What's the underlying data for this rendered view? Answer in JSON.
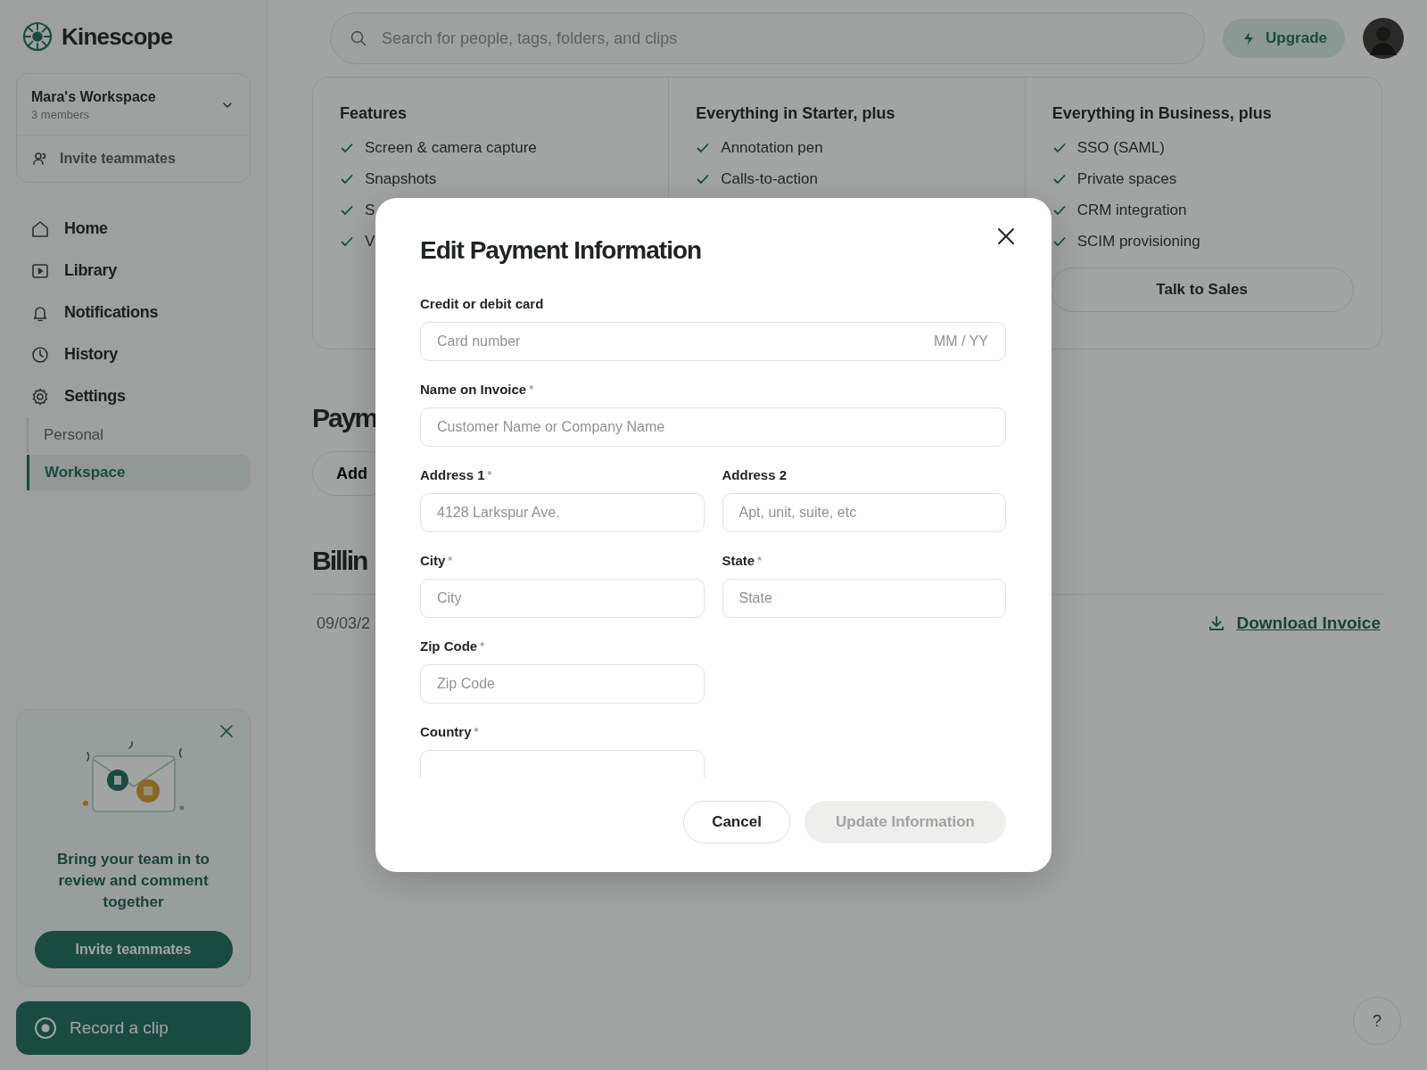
{
  "logo": {
    "text": "Kinescope"
  },
  "workspace": {
    "name": "Mara's Workspace",
    "members": "3 members",
    "invite": "Invite teammates"
  },
  "nav": [
    {
      "label": "Home"
    },
    {
      "label": "Library"
    },
    {
      "label": "Notifications"
    },
    {
      "label": "History"
    },
    {
      "label": "Settings"
    }
  ],
  "settings_sub": [
    {
      "label": "Personal",
      "selected": false
    },
    {
      "label": "Workspace",
      "selected": true
    }
  ],
  "promo": {
    "text": "Bring your team in to review and comment together",
    "button": "Invite teammates"
  },
  "record_button": "Record a clip",
  "search": {
    "placeholder": "Search for people, tags, folders, and clips"
  },
  "upgrade_button": "Upgrade",
  "plans": [
    {
      "heading": "Features",
      "features": [
        "Screen & camera capture",
        "Snapshots",
        "S",
        "V"
      ]
    },
    {
      "heading": "Everything in Starter, plus",
      "features": [
        "Annotation pen",
        "Calls-to-action"
      ]
    },
    {
      "heading": "Everything in Business, plus",
      "features": [
        "SSO (SAML)",
        "Private spaces",
        "CRM integration",
        "SCIM provisioning"
      ],
      "button": "Talk to Sales"
    }
  ],
  "payment": {
    "heading": "Paym",
    "button": "Add"
  },
  "billing": {
    "heading": "Billin",
    "rows": [
      {
        "date": "09/03/2",
        "link": "Download Invoice"
      }
    ]
  },
  "help_button": "?",
  "modal": {
    "title": "Edit Payment Information",
    "fields": [
      {
        "kind": "card",
        "label": "Credit or debit card",
        "placeholder": "Card number",
        "suffix": "MM / YY"
      },
      {
        "kind": "full",
        "label": "Name on Invoice",
        "required_mark": "*",
        "placeholder": "Customer Name or Company Name"
      },
      {
        "kind": "half",
        "label": "Address 1",
        "required_mark": "*",
        "placeholder": "4128 Larkspur Ave."
      },
      {
        "kind": "half",
        "label": "Address 2",
        "placeholder": "Apt, unit, suite, etc"
      },
      {
        "kind": "half",
        "label": "City",
        "required_mark": "*",
        "placeholder": "City"
      },
      {
        "kind": "half",
        "label": "State",
        "required_mark": "*",
        "placeholder": "State"
      },
      {
        "kind": "half-alone",
        "label": "Zip Code",
        "required_mark": "*",
        "placeholder": "Zip Code"
      },
      {
        "kind": "half-alone",
        "label": "Country",
        "required_mark": "*"
      }
    ],
    "cancel": "Cancel",
    "submit": {
      "label": "Update Information",
      "disabled": true
    }
  }
}
